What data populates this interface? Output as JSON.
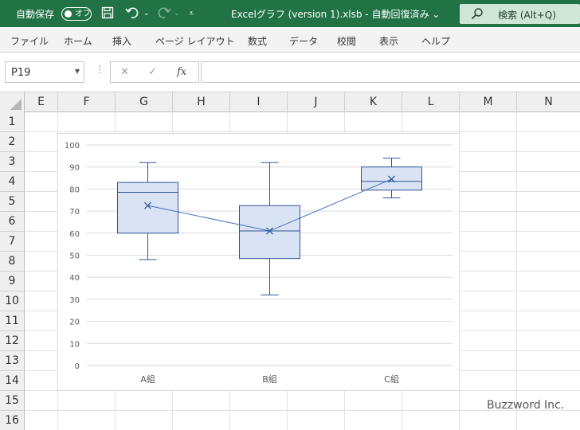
{
  "titlebar": {
    "autosave_label": "自動保存",
    "autosave_state": "オフ",
    "document_title": "Excelグラフ (version 1).xlsb  -  自動回復済み ⌄",
    "search_label": "検索 (Alt+Q)"
  },
  "menu": [
    "ファイル",
    "ホーム",
    "挿入",
    "ページ レイアウト",
    "数式",
    "データ",
    "校閲",
    "表示",
    "ヘルプ"
  ],
  "formula_bar": {
    "name_box": "P19",
    "cancel_icon": "✕",
    "enter_icon": "✓",
    "fx_label": "fx",
    "formula": ""
  },
  "columns": [
    "E",
    "F",
    "G",
    "H",
    "I",
    "J",
    "K",
    "L",
    "M",
    "N"
  ],
  "rows": [
    "1",
    "2",
    "3",
    "4",
    "5",
    "6",
    "7",
    "8",
    "9",
    "10",
    "11",
    "12",
    "13",
    "14",
    "15",
    "16"
  ],
  "chart_data": {
    "type": "boxplot",
    "title": "",
    "xlabel": "",
    "ylabel": "",
    "ylim": [
      0,
      100
    ],
    "yticks": [
      0,
      10,
      20,
      30,
      40,
      50,
      60,
      70,
      80,
      90,
      100
    ],
    "categories": [
      "A組",
      "B組",
      "C組"
    ],
    "boxes": [
      {
        "category": "A組",
        "min": 48,
        "q1": 60,
        "median": 78.5,
        "q3": 83,
        "max": 92,
        "mean": 72.5
      },
      {
        "category": "B組",
        "min": 32,
        "q1": 48.5,
        "median": 61,
        "q3": 72.5,
        "max": 92,
        "mean": 61
      },
      {
        "category": "C組",
        "min": 76,
        "q1": 79.5,
        "median": 83.5,
        "q3": 90,
        "max": 94,
        "mean": 84.5
      }
    ],
    "mean_line": true,
    "grid": true,
    "colors": {
      "box_fill": "#dae3f3",
      "box_stroke": "#2f5597",
      "grid": "#d9d9d9"
    }
  },
  "watermark": "Buzzword Inc."
}
